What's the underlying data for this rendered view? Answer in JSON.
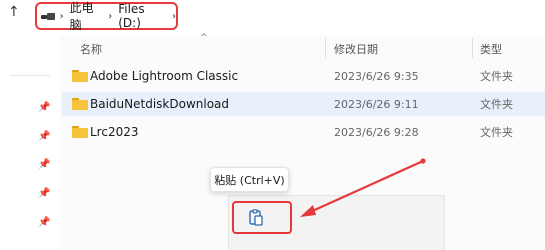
{
  "address_bar": {
    "breadcrumb": [
      "此电脑",
      "Files (D:)"
    ]
  },
  "columns": {
    "name": "名称",
    "date": "修改日期",
    "type": "类型"
  },
  "files": [
    {
      "name": "Adobe Lightroom Classic",
      "date": "2023/6/26 9:35",
      "type": "文件夹",
      "selected": false
    },
    {
      "name": "BaiduNetdiskDownload",
      "date": "2023/6/26 9:11",
      "type": "文件夹",
      "selected": true
    },
    {
      "name": "Lrc2023",
      "date": "2023/6/26 9:28",
      "type": "文件夹",
      "selected": false
    }
  ],
  "tooltip": {
    "text": "粘贴 (Ctrl+V)"
  },
  "icons": {
    "up": "up-arrow-icon",
    "drive": "drive-icon",
    "folder": "folder-icon",
    "pin": "pin-icon",
    "paste": "paste-icon"
  },
  "colors": {
    "annotation_red": "#e5393b",
    "selection": "#e8f0fb",
    "folder": "#f6c33d"
  }
}
